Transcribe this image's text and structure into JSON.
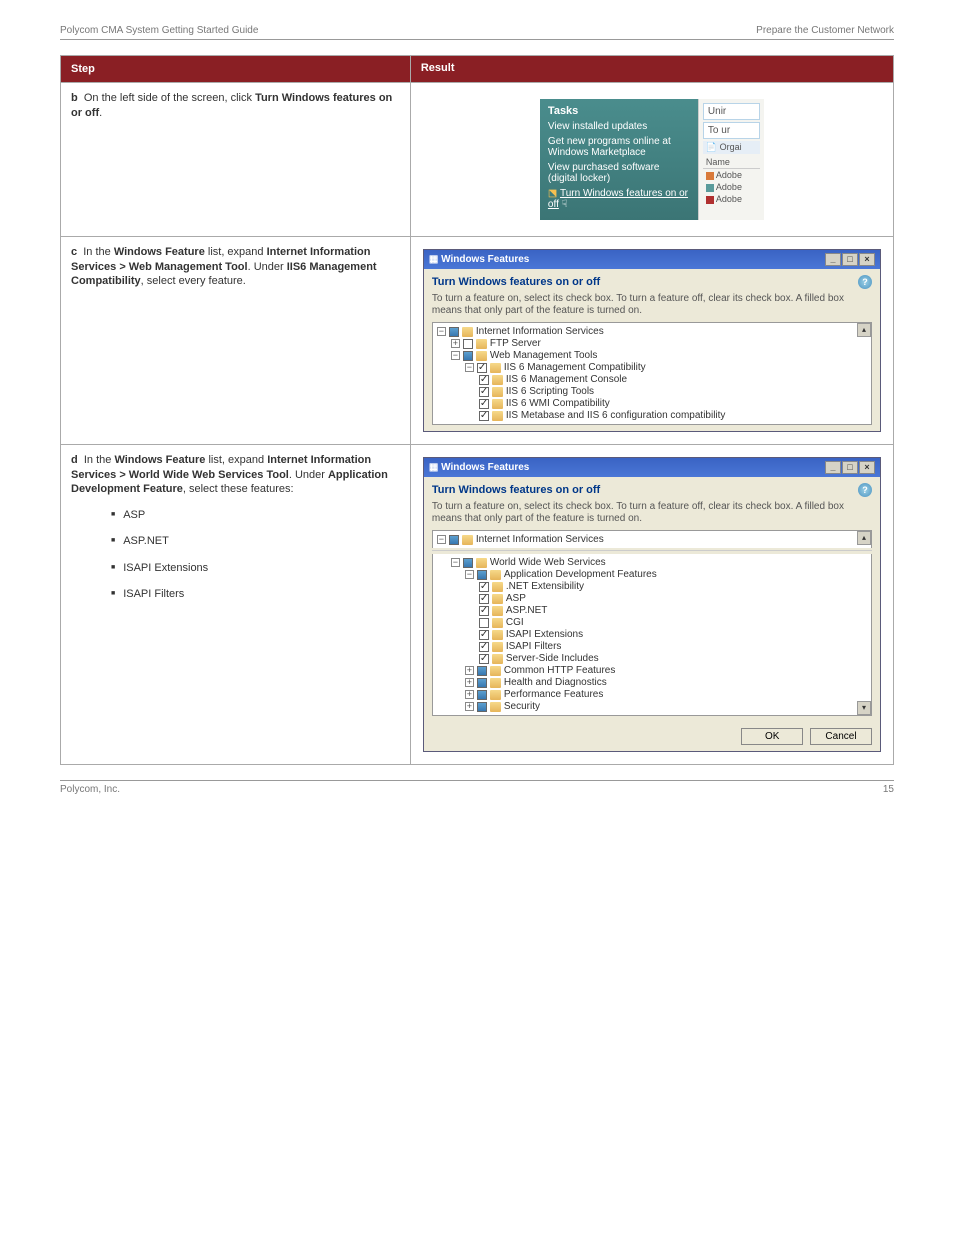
{
  "header": {
    "left": "Polycom CMA System Getting Started Guide",
    "right": "Prepare the Customer Network"
  },
  "footer": {
    "left": "Polycom, Inc.",
    "right": "15"
  },
  "table_header": {
    "step": "Step",
    "result": "Result"
  },
  "row1": {
    "step_prefix": "b",
    "step_label": "On the left side of the screen, click",
    "step_bold": "Turn Windows features on or off",
    "step_tail": ".",
    "tasks_title": "Tasks",
    "tasks_items": [
      "View installed updates",
      "Get new programs online at Windows Marketplace",
      "View purchased software (digital locker)"
    ],
    "tasks_link": "Turn Windows features on or off",
    "rp_unit": "Unir",
    "rp_tour": "To ur",
    "rp_orga": "Orgai",
    "rp_name": "Name",
    "rp_items": [
      "Adobe",
      "Adobe",
      "Adobe"
    ]
  },
  "row2": {
    "step_prefix": "c",
    "step_label": "In the",
    "step_bold1": "Windows Feature",
    "step_mid1": " list, expand",
    "step_bold2": "Internet Information Services > Web Management Tool",
    "step_mid2": ". Under",
    "step_bold3": "IIS6 Management Compatibility",
    "step_tail": ", select every feature."
  },
  "row3": {
    "step_prefix": "d",
    "step_label": "In the",
    "step_bold1": "Windows Feature",
    "step_mid1": " list, expand",
    "step_bold2": "Internet Information Services > World Wide Web Services Tool",
    "step_mid2": ". Under",
    "step_bold3": "Application Development Feature",
    "step_tail": ", select these features:",
    "checks": [
      "ASP",
      "ASP.NET",
      "ISAPI Extensions",
      "ISAPI Filters"
    ]
  },
  "wf": {
    "title": "Windows Features",
    "heading": "Turn Windows features on or off",
    "desc": "To turn a feature on, select its check box. To turn a feature off, clear its check box. A filled box means that only part of the feature is turned on.",
    "ok": "OK",
    "cancel": "Cancel",
    "tree1": {
      "root": "Internet Information Services",
      "ftp": "FTP Server",
      "wmt": "Web Management Tools",
      "iis6": "IIS 6 Management Compatibility",
      "items": [
        "IIS 6 Management Console",
        "IIS 6 Scripting Tools",
        "IIS 6 WMI Compatibility",
        "IIS Metabase and IIS 6 configuration compatibility"
      ]
    },
    "tree2": {
      "root": "Internet Information Services",
      "www": "World Wide Web Services",
      "adf": "Application Development Features",
      "adf_items": [
        {
          "label": ".NET Extensibility",
          "checked": true
        },
        {
          "label": "ASP",
          "checked": true
        },
        {
          "label": "ASP.NET",
          "checked": true
        },
        {
          "label": "CGI",
          "checked": false
        },
        {
          "label": "ISAPI Extensions",
          "checked": true
        },
        {
          "label": "ISAPI Filters",
          "checked": true
        },
        {
          "label": "Server-Side Includes",
          "checked": true
        }
      ],
      "others": [
        "Common HTTP Features",
        "Health and Diagnostics",
        "Performance Features",
        "Security"
      ]
    }
  }
}
